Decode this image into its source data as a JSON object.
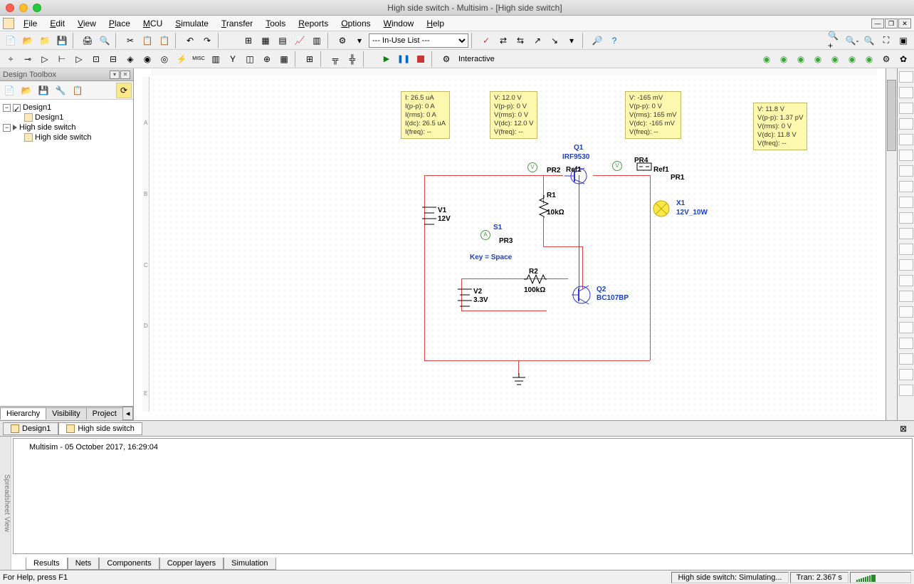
{
  "title": "High side switch - Multisim - [High side switch]",
  "menu": [
    "File",
    "Edit",
    "View",
    "Place",
    "MCU",
    "Simulate",
    "Transfer",
    "Tools",
    "Reports",
    "Options",
    "Window",
    "Help"
  ],
  "in_use": "--- In-Use List ---",
  "interactive": "Interactive",
  "toolbox_title": "Design Toolbox",
  "tree": {
    "d1": "Design1",
    "hs": "High side switch"
  },
  "left_tabs": [
    "Hierarchy",
    "Visibility",
    "Project"
  ],
  "notes": {
    "n1": [
      "I: 26.5 uA",
      "I(p-p): 0 A",
      "I(rms): 0 A",
      "I(dc): 26.5 uA",
      "I(freq): --"
    ],
    "n2": [
      "V: 12.0 V",
      "V(p-p): 0 V",
      "V(rms): 0 V",
      "V(dc): 12.0 V",
      "V(freq): --"
    ],
    "n3": [
      "V: -165 mV",
      "V(p-p): 0 V",
      "V(rms): 165 mV",
      "V(dc): -165 mV",
      "V(freq): --"
    ],
    "n4": [
      "V: 11.8 V",
      "V(p-p): 1.37 pV",
      "V(rms): 0 V",
      "V(dc): 11.8 V",
      "V(freq): --"
    ]
  },
  "comps": {
    "q1": "Q1",
    "q1_part": "IRF9530",
    "q2": "Q2",
    "q2_part": "BC107BP",
    "r1": "R1",
    "r1_val": "10kΩ",
    "r2": "R2",
    "r2_val": "100kΩ",
    "v1": "V1",
    "v1_val": "12V",
    "v2": "V2",
    "v2_val": "3.3V",
    "s1": "S1",
    "s1_key": "Key = Space",
    "x1": "X1",
    "x1_val": "12V_10W",
    "pr1": "PR1",
    "pr2": "PR2",
    "pr3": "PR3",
    "pr4": "PR4",
    "ref1a": "Ref1",
    "ref1b": "Ref1"
  },
  "ruler_v": [
    "A",
    "B",
    "C",
    "D",
    "E"
  ],
  "doc_tabs": [
    "Design1",
    "High side switch"
  ],
  "log_line": "Multisim  -  05 October 2017, 16:29:04",
  "bottom_tabs": [
    "Results",
    "Nets",
    "Components",
    "Copper layers",
    "Simulation"
  ],
  "status": {
    "help": "For Help, press F1",
    "sim": "High side switch: Simulating...",
    "tran": "Tran: 2.367 s"
  },
  "side_label": "Spreadsheet View"
}
